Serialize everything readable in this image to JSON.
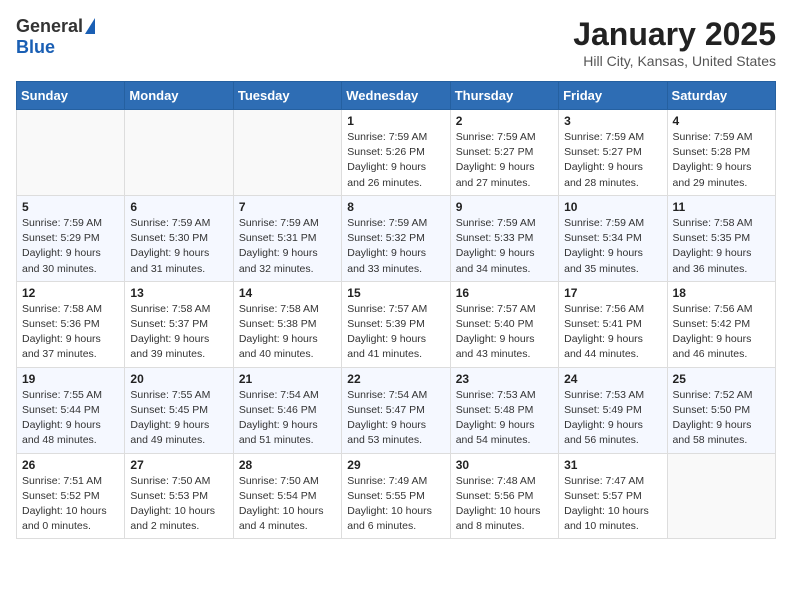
{
  "header": {
    "logo_general": "General",
    "logo_blue": "Blue",
    "month_title": "January 2025",
    "location": "Hill City, Kansas, United States"
  },
  "days_of_week": [
    "Sunday",
    "Monday",
    "Tuesday",
    "Wednesday",
    "Thursday",
    "Friday",
    "Saturday"
  ],
  "weeks": [
    [
      {
        "day": "",
        "info": ""
      },
      {
        "day": "",
        "info": ""
      },
      {
        "day": "",
        "info": ""
      },
      {
        "day": "1",
        "info": "Sunrise: 7:59 AM\nSunset: 5:26 PM\nDaylight: 9 hours and 26 minutes."
      },
      {
        "day": "2",
        "info": "Sunrise: 7:59 AM\nSunset: 5:27 PM\nDaylight: 9 hours and 27 minutes."
      },
      {
        "day": "3",
        "info": "Sunrise: 7:59 AM\nSunset: 5:27 PM\nDaylight: 9 hours and 28 minutes."
      },
      {
        "day": "4",
        "info": "Sunrise: 7:59 AM\nSunset: 5:28 PM\nDaylight: 9 hours and 29 minutes."
      }
    ],
    [
      {
        "day": "5",
        "info": "Sunrise: 7:59 AM\nSunset: 5:29 PM\nDaylight: 9 hours and 30 minutes."
      },
      {
        "day": "6",
        "info": "Sunrise: 7:59 AM\nSunset: 5:30 PM\nDaylight: 9 hours and 31 minutes."
      },
      {
        "day": "7",
        "info": "Sunrise: 7:59 AM\nSunset: 5:31 PM\nDaylight: 9 hours and 32 minutes."
      },
      {
        "day": "8",
        "info": "Sunrise: 7:59 AM\nSunset: 5:32 PM\nDaylight: 9 hours and 33 minutes."
      },
      {
        "day": "9",
        "info": "Sunrise: 7:59 AM\nSunset: 5:33 PM\nDaylight: 9 hours and 34 minutes."
      },
      {
        "day": "10",
        "info": "Sunrise: 7:59 AM\nSunset: 5:34 PM\nDaylight: 9 hours and 35 minutes."
      },
      {
        "day": "11",
        "info": "Sunrise: 7:58 AM\nSunset: 5:35 PM\nDaylight: 9 hours and 36 minutes."
      }
    ],
    [
      {
        "day": "12",
        "info": "Sunrise: 7:58 AM\nSunset: 5:36 PM\nDaylight: 9 hours and 37 minutes."
      },
      {
        "day": "13",
        "info": "Sunrise: 7:58 AM\nSunset: 5:37 PM\nDaylight: 9 hours and 39 minutes."
      },
      {
        "day": "14",
        "info": "Sunrise: 7:58 AM\nSunset: 5:38 PM\nDaylight: 9 hours and 40 minutes."
      },
      {
        "day": "15",
        "info": "Sunrise: 7:57 AM\nSunset: 5:39 PM\nDaylight: 9 hours and 41 minutes."
      },
      {
        "day": "16",
        "info": "Sunrise: 7:57 AM\nSunset: 5:40 PM\nDaylight: 9 hours and 43 minutes."
      },
      {
        "day": "17",
        "info": "Sunrise: 7:56 AM\nSunset: 5:41 PM\nDaylight: 9 hours and 44 minutes."
      },
      {
        "day": "18",
        "info": "Sunrise: 7:56 AM\nSunset: 5:42 PM\nDaylight: 9 hours and 46 minutes."
      }
    ],
    [
      {
        "day": "19",
        "info": "Sunrise: 7:55 AM\nSunset: 5:44 PM\nDaylight: 9 hours and 48 minutes."
      },
      {
        "day": "20",
        "info": "Sunrise: 7:55 AM\nSunset: 5:45 PM\nDaylight: 9 hours and 49 minutes."
      },
      {
        "day": "21",
        "info": "Sunrise: 7:54 AM\nSunset: 5:46 PM\nDaylight: 9 hours and 51 minutes."
      },
      {
        "day": "22",
        "info": "Sunrise: 7:54 AM\nSunset: 5:47 PM\nDaylight: 9 hours and 53 minutes."
      },
      {
        "day": "23",
        "info": "Sunrise: 7:53 AM\nSunset: 5:48 PM\nDaylight: 9 hours and 54 minutes."
      },
      {
        "day": "24",
        "info": "Sunrise: 7:53 AM\nSunset: 5:49 PM\nDaylight: 9 hours and 56 minutes."
      },
      {
        "day": "25",
        "info": "Sunrise: 7:52 AM\nSunset: 5:50 PM\nDaylight: 9 hours and 58 minutes."
      }
    ],
    [
      {
        "day": "26",
        "info": "Sunrise: 7:51 AM\nSunset: 5:52 PM\nDaylight: 10 hours and 0 minutes."
      },
      {
        "day": "27",
        "info": "Sunrise: 7:50 AM\nSunset: 5:53 PM\nDaylight: 10 hours and 2 minutes."
      },
      {
        "day": "28",
        "info": "Sunrise: 7:50 AM\nSunset: 5:54 PM\nDaylight: 10 hours and 4 minutes."
      },
      {
        "day": "29",
        "info": "Sunrise: 7:49 AM\nSunset: 5:55 PM\nDaylight: 10 hours and 6 minutes."
      },
      {
        "day": "30",
        "info": "Sunrise: 7:48 AM\nSunset: 5:56 PM\nDaylight: 10 hours and 8 minutes."
      },
      {
        "day": "31",
        "info": "Sunrise: 7:47 AM\nSunset: 5:57 PM\nDaylight: 10 hours and 10 minutes."
      },
      {
        "day": "",
        "info": ""
      }
    ]
  ]
}
